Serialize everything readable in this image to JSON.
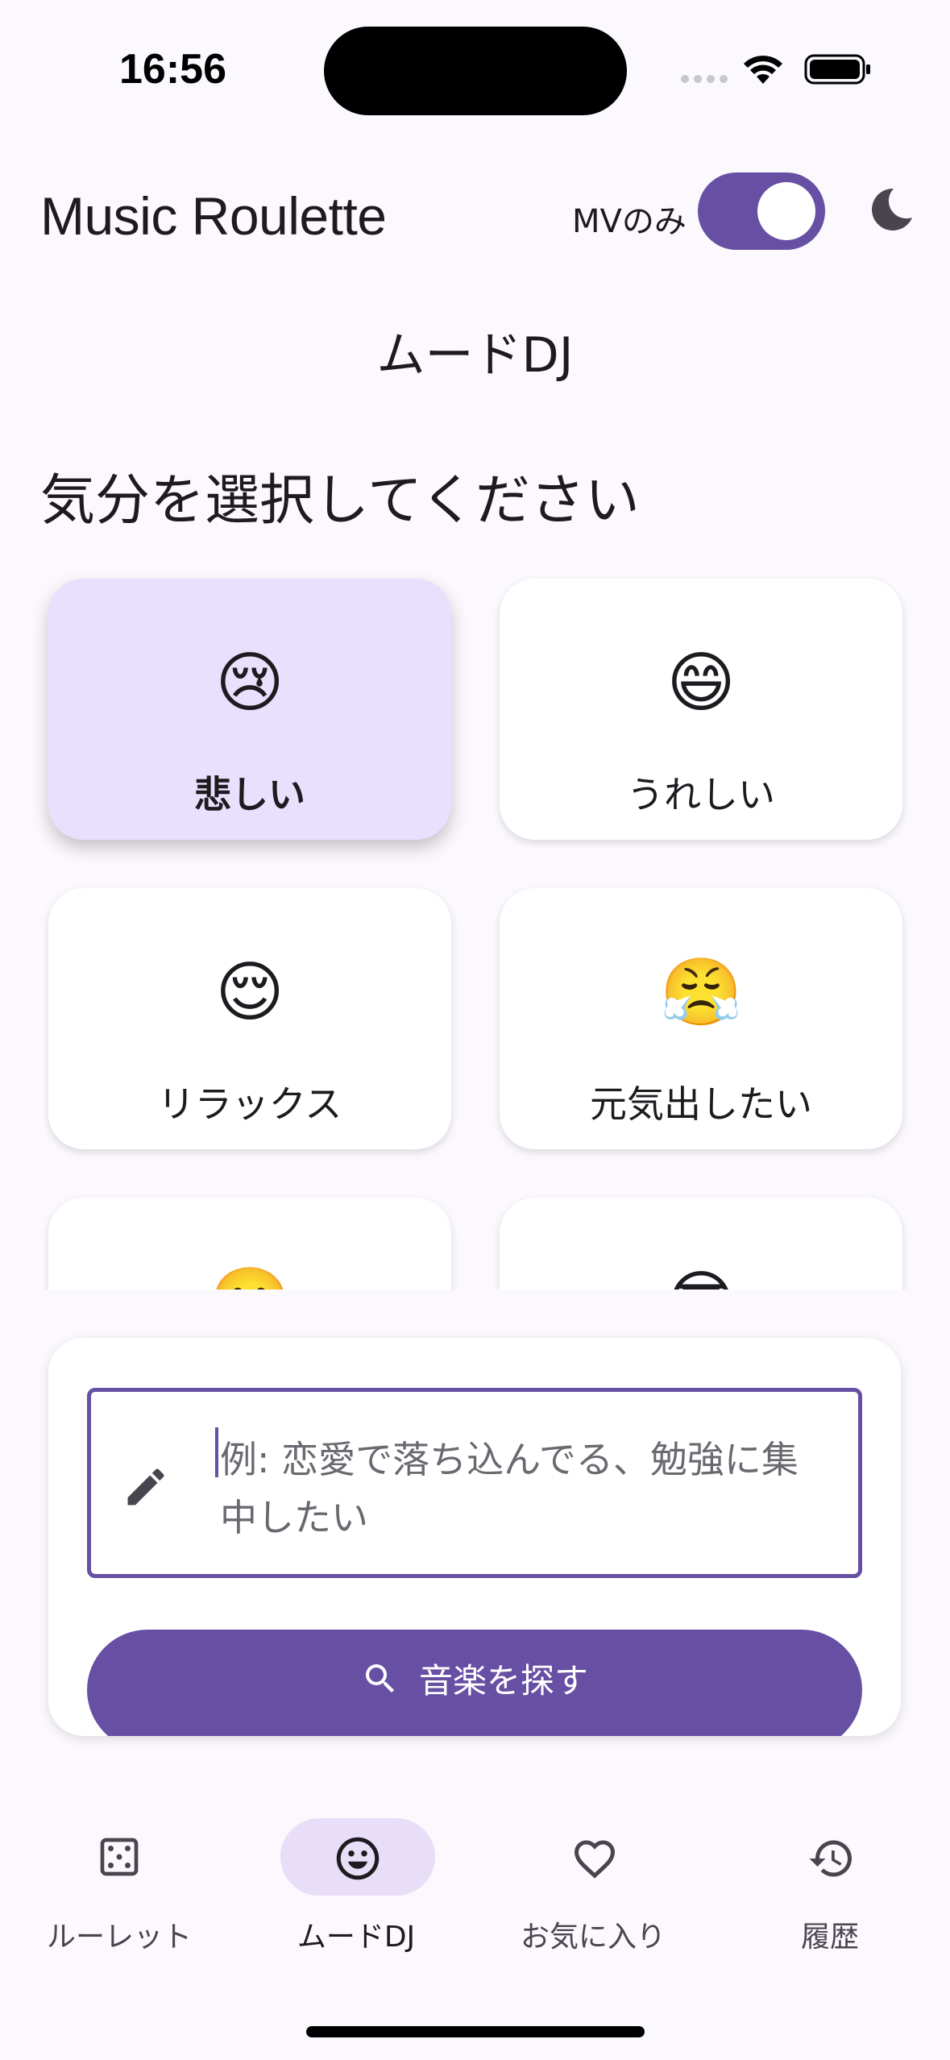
{
  "status_bar": {
    "time": "16:56"
  },
  "app_bar": {
    "title": "Music Roulette",
    "mv_only_label": "MVのみ",
    "mv_only_enabled": true
  },
  "page": {
    "heading": "ムードDJ",
    "section_title": "気分を選択してください"
  },
  "moods": [
    {
      "emoji": "😢",
      "label": "悲しい",
      "selected": true
    },
    {
      "emoji": "😄",
      "label": "うれしい",
      "selected": false
    },
    {
      "emoji": "😌",
      "label": "リラックス",
      "selected": false
    },
    {
      "emoji": "😤",
      "label": "元気出したい",
      "selected": false
    },
    {
      "emoji": "🥲",
      "label": "",
      "selected": false
    },
    {
      "emoji": "😎",
      "label": "",
      "selected": false
    }
  ],
  "search": {
    "placeholder": "例: 恋愛で落ち込んでる、勉強に集中したい",
    "button_label": "音楽を探す"
  },
  "bottom_nav": [
    {
      "label": "ルーレット",
      "icon": "dice-icon",
      "active": false
    },
    {
      "label": "ムードDJ",
      "icon": "smiley-icon",
      "active": true
    },
    {
      "label": "お気に入り",
      "icon": "heart-icon",
      "active": false
    },
    {
      "label": "履歴",
      "icon": "history-icon",
      "active": false
    }
  ],
  "colors": {
    "accent": "#6750a4",
    "selected_card": "#e8e0fc",
    "nav_indicator": "#e8def8",
    "background": "#fbf8fe"
  }
}
